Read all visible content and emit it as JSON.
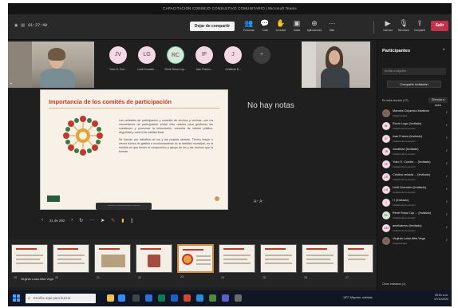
{
  "window": {
    "title": "CAPACITACIÓN CONSEJO CONSULTIVO COMUNITARIO | Microsoft Teams"
  },
  "toolbar": {
    "timer": "01:27:49",
    "stop_share_label": "Dejar de compartir",
    "buttons": [
      {
        "icon": "people-icon",
        "glyph": "👥",
        "label": "Personas"
      },
      {
        "icon": "chat-icon",
        "glyph": "💬",
        "label": "Chat"
      },
      {
        "icon": "raise-hand-icon",
        "glyph": "✋",
        "label": "Levantar"
      },
      {
        "icon": "rooms-icon",
        "glyph": "▣",
        "label": "Salas"
      },
      {
        "icon": "apps-icon",
        "glyph": "⊕",
        "label": "Aplicaciones"
      },
      {
        "icon": "more-icon",
        "glyph": "···",
        "label": "Más"
      },
      {
        "icon": "camera-icon",
        "glyph": "▶",
        "label": "Cámara"
      },
      {
        "icon": "mic-icon",
        "glyph": "🎙",
        "label": "Micrófono"
      },
      {
        "icon": "share-icon",
        "glyph": "⇪",
        "label": "Compartir"
      }
    ],
    "leave_label": "Salir"
  },
  "stage": {
    "left_video_name": "",
    "avatars": [
      {
        "initials": "JV",
        "name": "Yuko S. Curi..."
      },
      {
        "initials": "LG",
        "name": "Leidi Gonzale..."
      },
      {
        "initials": "RC",
        "name": "René Rosa Cup..."
      },
      {
        "initials": "IF",
        "name": "Ivan Franco..."
      },
      {
        "initials": "J",
        "name": "Jonathan B..."
      },
      {
        "initials": "+",
        "name": ""
      }
    ]
  },
  "slide": {
    "title": "Importancia de los comités de participación",
    "paragraph1": "Las unidades de participación y consulta de vecinos y vecinas, son los mecanismos de participación social más usados para gestionar las cuestiones y promover la información, consulta de interés público, seguridad y control de calidad local.",
    "paragraph2": "Se forman por iniciativa de los y las propias vecinas. Tienen mayor o menor fuerza de gestión e involucramiento en la realidad municipal, en la medida en que tienen el compromiso y apoyo de los y las vecinos que la forman.",
    "caption": "──── ──────── ────"
  },
  "presenter_controls": {
    "page": "21 de 292",
    "back_icon": "‹",
    "next_icon": "›",
    "sync_icon": "↻",
    "more_icon": "···"
  },
  "notes": {
    "empty_label": "No hay notas"
  },
  "thumbnails": {
    "caption": "Virginia Luisa Alba Vega",
    "items": [
      {
        "num": "19"
      },
      {
        "num": "20"
      },
      {
        "num": "21"
      },
      {
        "num": "22"
      },
      {
        "num": "23"
      },
      {
        "num": "24"
      },
      {
        "num": "25"
      },
      {
        "num": "26"
      },
      {
        "num": "27"
      }
    ],
    "selected_index": 4
  },
  "participants_panel": {
    "title": "Participantes",
    "invite_placeholder": "Invitar a alguien",
    "share_invite_label": "Compartir invitación",
    "section_header": "En esta reunión (17)",
    "mute_all_label": "Silenciar a todos",
    "participants": [
      {
        "initials": "MC",
        "name": "Marcela Cinjamez Martínez",
        "sub": "Organizadora"
      },
      {
        "initials": "RL",
        "name": "Rocío Lugo (Invitado)",
        "sub": "Invitado de la reunión"
      },
      {
        "initials": "IF",
        "name": "Ivan Franco (Invitado)",
        "sub": "Invitado de la reunión"
      },
      {
        "initials": "JB",
        "name": "Jonathan (Invitado)",
        "sub": "Invitado de la reunión"
      },
      {
        "initials": "YC",
        "name": "Yuko S. Curulto ... (Invitado)",
        "sub": "Invitado de la reunión"
      },
      {
        "initials": "CE",
        "name": "Cristina velasta ... (Invitado)",
        "sub": "Invitado de la reunión"
      },
      {
        "initials": "LG",
        "name": "Leidi Gonzalez (Invitado)",
        "sub": "Invitado de la reunión"
      },
      {
        "initials": "I",
        "name": "I I (Invitado)",
        "sub": "Invitado de la reunión"
      },
      {
        "initials": "RC",
        "name": "René Rosa Cup ... (Invitado)",
        "sub": "Invitado de la reunión"
      },
      {
        "initials": "AM",
        "name": "ameliatrevo (Invitado)",
        "sub": "Invitado de la reunión"
      },
      {
        "initials": "VV",
        "name": "Virginia Luisa Alba Vega",
        "sub": "Organizadora"
      }
    ],
    "others_label": "Otros invitados (1)"
  },
  "taskbar": {
    "search_placeholder": "Escribe aquí para buscar",
    "weather": "18°C Mayorm. nublado",
    "time": "09:51 a.m.",
    "date": "07/11/2022"
  }
}
